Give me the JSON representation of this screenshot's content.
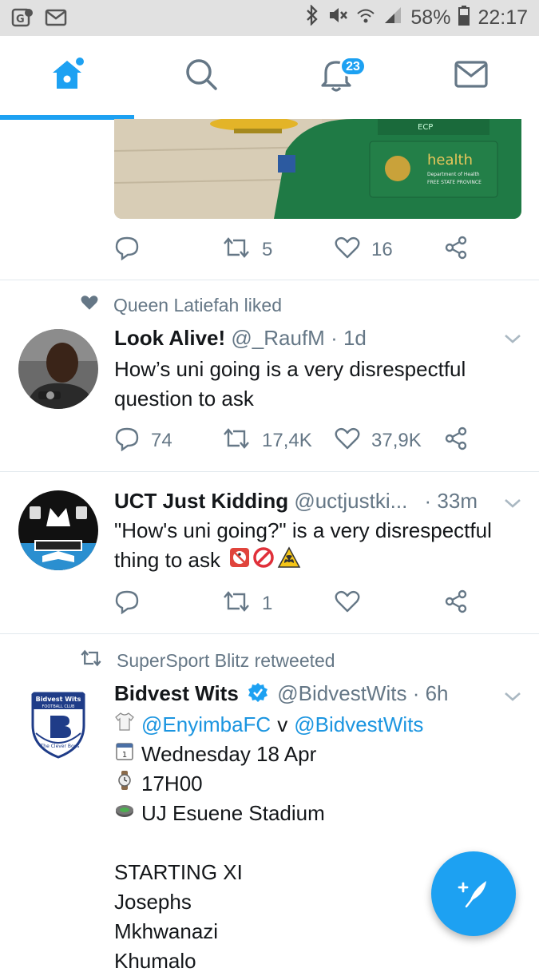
{
  "status_bar": {
    "battery": "58%",
    "time": "22:17"
  },
  "nav": {
    "notifications_badge": "23"
  },
  "tweet0": {
    "retweets": "5",
    "likes": "16"
  },
  "tweet1": {
    "social": "Queen Latiefah liked",
    "name": "Look Alive!",
    "handle": "@_RaufM",
    "time": "· 1d",
    "text": "How’s uni going is a very disrespectful question to ask",
    "replies": "74",
    "retweets": "17,4K",
    "likes": "37,9K"
  },
  "tweet2": {
    "name": "UCT Just Kidding",
    "handle": "@uctjustki...",
    "time": "· 33m",
    "text": "\"How's uni going?\" is a very disrespectful thing to ask",
    "retweets": "1"
  },
  "tweet3": {
    "social": "SuperSport Blitz retweeted",
    "name": "Bidvest Wits",
    "handle": "@BidvestWits",
    "time": "· 6h",
    "mention1": "@EnyimbaFC",
    "vs": "v",
    "mention2": "@BidvestWits",
    "date": "Wednesday 18 Apr",
    "kickoff": "17H00",
    "venue": "UJ Esuene Stadium",
    "heading": "STARTING XI",
    "players": [
      "Josephs",
      "Mkhwanazi",
      "Khumalo"
    ],
    "avatar_text": {
      "top": "Bidvest Wits",
      "sub": "FOOTBALL CLUB",
      "ribbon": "The Clever Boys"
    }
  },
  "colors": {
    "accent": "#1da1f2",
    "secondary_text": "#657786",
    "status_bar_bg": "#e1e1e1"
  }
}
